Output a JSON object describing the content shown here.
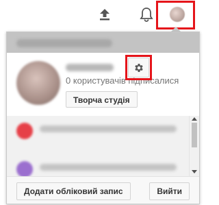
{
  "topbar": {
    "upload_icon": "upload-arrow-icon",
    "notifications_icon": "bell-icon",
    "avatar_icon": "account-avatar"
  },
  "menu": {
    "subscribers_text": "0 користувачів підписалися",
    "studio_button_label": "Творча студія",
    "settings_icon": "gear-icon",
    "add_account_label": "Додати обліковий запис",
    "sign_out_label": "Вийти"
  },
  "colors": {
    "highlight": "#e5141a",
    "header_bg": "#c3c3c3",
    "channels_bg": "#f1f1f1"
  }
}
